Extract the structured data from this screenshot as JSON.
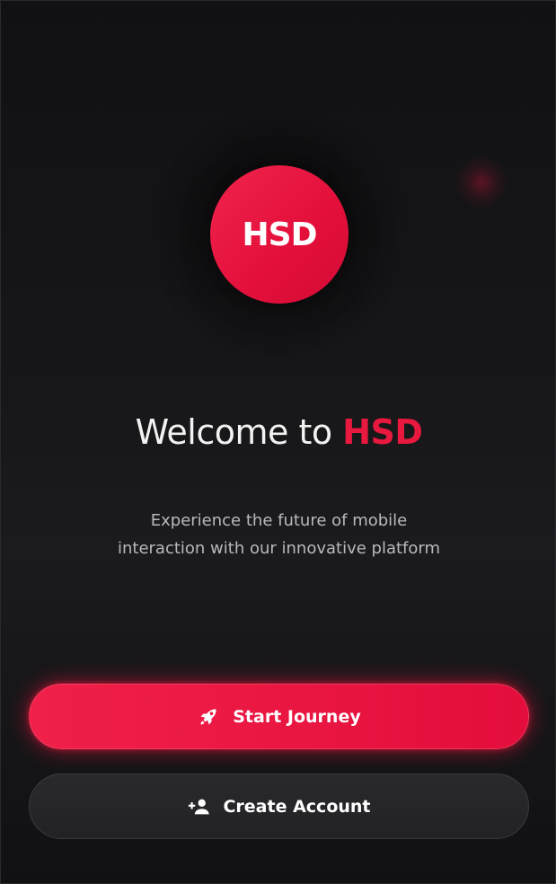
{
  "logo": {
    "text": "HSD"
  },
  "welcome": {
    "prefix": "Welcome to ",
    "brand": "HSD"
  },
  "subtitle": {
    "line1": "Experience the future of mobile",
    "line2": "interaction with our innovative platform"
  },
  "buttons": {
    "start": {
      "label": "Start Journey",
      "icon": "rocket-icon"
    },
    "create": {
      "label": "Create Account",
      "icon": "add-user-icon"
    }
  },
  "colors": {
    "accent": "#e8183f",
    "background": "#141416"
  }
}
